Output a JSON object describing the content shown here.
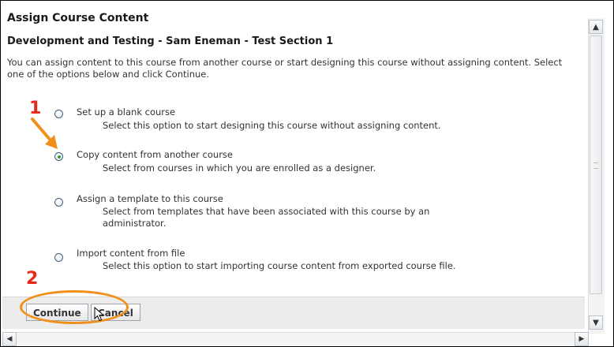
{
  "dialog": {
    "title": "Assign Course Content",
    "subtitle": "Development and Testing - Sam Eneman - Test Section 1",
    "intro": "You can assign content to this course from another course or start designing this course without assigning content. Select one of the options below and click Continue."
  },
  "options": [
    {
      "label": "Set up a blank course",
      "desc": "Select this option to start designing this course without assigning content.",
      "checked": false
    },
    {
      "label": "Copy content from another course",
      "desc": "Select from courses in which you are enrolled as a designer.",
      "checked": true
    },
    {
      "label": "Assign a template to this course",
      "desc": "Select from templates that have been associated with this course by an administrator.",
      "checked": false
    },
    {
      "label": "Import content from file",
      "desc": "Select this option to start importing course content from exported course file.",
      "checked": false
    }
  ],
  "annotations": {
    "step1": "1",
    "step2": "2"
  },
  "buttons": {
    "continue": "Continue",
    "cancel": "Cancel"
  },
  "colors": {
    "annotation_red": "#e8281a",
    "annotation_orange": "#f0901a",
    "radio_checked": "#3a9a3a"
  }
}
